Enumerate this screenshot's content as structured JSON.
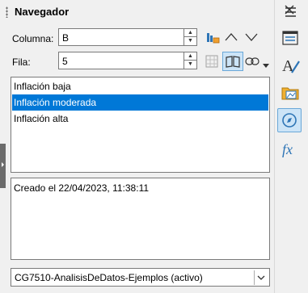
{
  "panel": {
    "title": "Navegador"
  },
  "columna": {
    "label": "Columna:",
    "value": "B"
  },
  "fila": {
    "label": "Fila:",
    "value": "5"
  },
  "list": {
    "items": [
      "Inflación baja",
      "Inflación moderada",
      "Inflación alta"
    ],
    "selected_index": 1
  },
  "comment": {
    "text": "Creado el 22/04/2023, 11:38:11"
  },
  "document": {
    "selected": "CG7510-AnalisisDeDatos-Ejemplos (activo)"
  },
  "colors": {
    "selection": "#0078d7",
    "accent": "#2e75b6",
    "active_tab_bg": "#cce4f7"
  },
  "icons": {
    "toolbar": [
      "data-range-icon",
      "arrow-up-icon",
      "arrow-down-icon",
      "scenario-icon",
      "book-icon",
      "link-icon",
      "dropdown-arrow-icon"
    ],
    "sidebar": [
      "properties-icon",
      "styles-icon",
      "gallery-icon",
      "navigator-icon",
      "functions-icon"
    ]
  }
}
